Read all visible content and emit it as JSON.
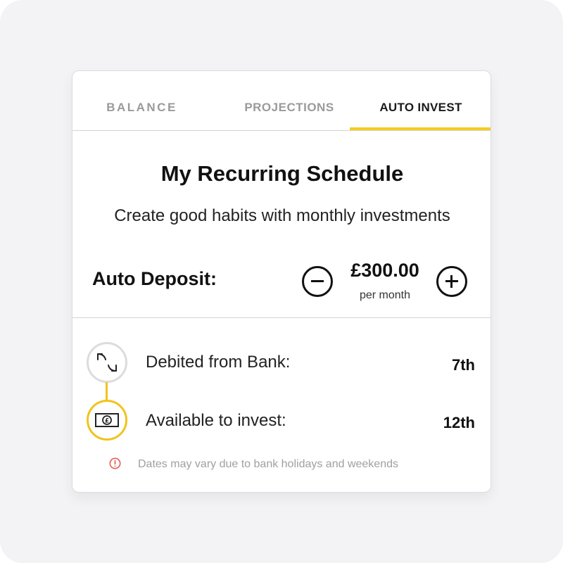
{
  "tabs": [
    {
      "label": "BALANCE",
      "active": false
    },
    {
      "label": "PROJECTIONS",
      "active": false
    },
    {
      "label": "AUTO INVEST",
      "active": true
    }
  ],
  "accent_color": "#f5cc1f",
  "schedule": {
    "title": "My Recurring Schedule",
    "subtitle": "Create good habits with monthly investments"
  },
  "deposit": {
    "label": "Auto Deposit:",
    "amount": "£300.00",
    "period": "per month",
    "decrease_icon": "minus-circle-icon",
    "increase_icon": "plus-circle-icon"
  },
  "steps": [
    {
      "icon": "exchange-arrows-icon",
      "label": "Debited from Bank:",
      "value": "7th"
    },
    {
      "icon": "pound-banknote-icon",
      "label": "Available to invest:",
      "value": "12th"
    }
  ],
  "note": {
    "icon": "warning-icon",
    "text": "Dates may vary due to bank holidays and weekends",
    "icon_color": "#e8554b"
  }
}
